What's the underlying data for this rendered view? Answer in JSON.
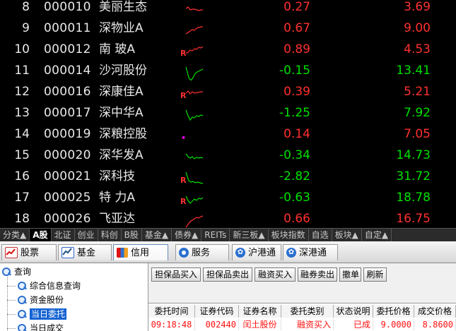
{
  "quotes": [
    {
      "idx": "8",
      "code": "000010",
      "name": "美丽生态",
      "r": "",
      "change": "0.27",
      "price": "3.69",
      "dir": "up",
      "spark": "1,12 4,10 7,14 10,13 13,13 16,14 19,15 22,14 25,14"
    },
    {
      "idx": "9",
      "code": "000011",
      "name": "深物业A",
      "r": "",
      "change": "0.67",
      "price": "9.00",
      "dir": "up",
      "spark": "1,18 4,16 7,14 10,12 13,13 16,10 19,9 22,8 25,8"
    },
    {
      "idx": "10",
      "code": "000012",
      "name": "南 玻A",
      "r": "R",
      "change": "0.89",
      "price": "4.53",
      "dir": "up",
      "spark": "1,16 4,14 7,11 10,12 13,9 16,10 19,7 22,8 25,6"
    },
    {
      "idx": "11",
      "code": "000014",
      "name": "沙河股份",
      "r": "",
      "change": "-0.15",
      "price": "13.41",
      "dir": "down",
      "spark": "1,5 3,12 5,20 8,24 11,20 14,14 17,12 21,10 25,8"
    },
    {
      "idx": "12",
      "code": "000016",
      "name": "深康佳A",
      "r": "R",
      "change": "0.39",
      "price": "5.21",
      "dir": "up",
      "spark": "1,12 4,9 7,13 10,10 13,12 16,11 19,11 22,10 25,10"
    },
    {
      "idx": "13",
      "code": "000017",
      "name": "深中华A",
      "r": "",
      "change": "-1.25",
      "price": "7.92",
      "dir": "down",
      "spark": "1,6 4,14 7,20 10,16 13,17 16,14 19,15 22,13 25,14"
    },
    {
      "idx": "14",
      "code": "000019",
      "name": "深粮控股",
      "r": "•",
      "change": "0.14",
      "price": "7.05",
      "dir": "up",
      "spark": ""
    },
    {
      "idx": "15",
      "code": "000020",
      "name": "深华发A",
      "r": "",
      "change": "-0.34",
      "price": "14.73",
      "dir": "down",
      "spark": "1,8 4,12 7,14 10,12 13,15 16,13 19,14 22,13 25,14"
    },
    {
      "idx": "16",
      "code": "000021",
      "name": "深科技",
      "r": "R",
      "change": "-2.82",
      "price": "31.72",
      "dir": "down",
      "spark": "1,4 3,10 5,16 8,18 11,17 14,19 17,18 21,19 25,20"
    },
    {
      "idx": "17",
      "code": "000025",
      "name": "特 力A",
      "r": "R",
      "change": "-0.63",
      "price": "18.78",
      "dir": "down",
      "spark": "1,8 4,14 7,18 10,15 13,12 16,14 19,11 22,12 25,10"
    },
    {
      "idx": "18",
      "code": "000026",
      "name": "飞亚达",
      "r": "",
      "change": "0.66",
      "price": "16.75",
      "dir": "up",
      "spark": "1,22 4,18 7,14 10,12 13,10 16,8 19,9 22,7 25,6"
    }
  ],
  "market_tabs": [
    "分类▲",
    "A股",
    "北证",
    "创业",
    "科创",
    "B股",
    "基金▲",
    "债券▲",
    "REITs",
    "新三板▲",
    "板块指数",
    "自选",
    "板块▲",
    "自定▲"
  ],
  "market_active": "A股",
  "func_tabs": [
    {
      "label": "股票",
      "icon": "stock-chart-icon"
    },
    {
      "label": "基金",
      "icon": "fund-chart-icon"
    },
    {
      "label": "信用",
      "icon": "credit-icon"
    },
    {
      "label": "服务",
      "icon": "service-icon"
    },
    {
      "label": "沪港通",
      "icon": "hk-sh-connect-icon"
    },
    {
      "label": "深港通",
      "icon": "hk-sz-connect-icon"
    }
  ],
  "func_active": "信用",
  "tree": {
    "root": "查询",
    "items": [
      "综合信息查询",
      "资金股份",
      "当日委托",
      "当日成交"
    ],
    "selected": "当日委托"
  },
  "toolbar": [
    "担保品买入",
    "担保品卖出",
    "融资买入",
    "融券卖出",
    "撤单",
    "刷新"
  ],
  "table": {
    "headers": [
      "委托时间",
      "证券代码",
      "证券名称",
      "委托类别",
      "状态说明",
      "委托价格",
      "成交价格"
    ],
    "rows": [
      [
        "09:18:48",
        "002440",
        "闰土股份",
        "融资买入",
        "已成",
        "9.0000",
        "8.8600"
      ]
    ]
  },
  "colors": {
    "up": "#ff3030",
    "down": "#00e000",
    "selection": "#1463d2"
  }
}
